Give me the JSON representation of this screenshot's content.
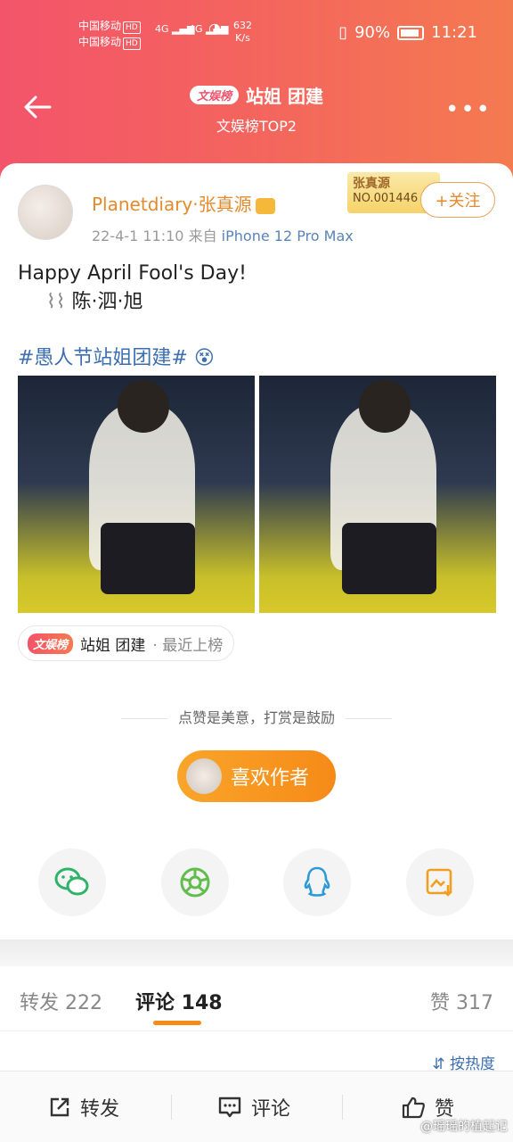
{
  "status_bar": {
    "carrier1": "中国移动",
    "carrier2": "中国移动",
    "hd": "HD",
    "net1": "4G",
    "net2": "4G",
    "speed_value": "632",
    "speed_unit": "K/s",
    "battery": "90%",
    "time": "11:21"
  },
  "header": {
    "badge": "文娱榜",
    "title": "站姐 团建",
    "subtitle": "文娱榜TOP2"
  },
  "post": {
    "username": "Planetdiary·张真源",
    "date": "22-4-1 11:10",
    "from_label": "来自",
    "device": "iPhone 12 Pro Max",
    "fan_badge_name": "张真源",
    "fan_badge_no": "NO.001446",
    "follow_label": "+关注",
    "text_line1": "Happy April Fool's Day!",
    "text_line2": "陈·泗·旭",
    "hashtag": "#愚人节站姐团建#",
    "chip_badge": "文娱榜",
    "chip_title": "站姐 团建",
    "chip_status": "· 最近上榜"
  },
  "reward": {
    "encourage_text": "点赞是美意，打赏是鼓励",
    "like_author_label": "喜欢作者"
  },
  "share": {
    "icons": [
      "wechat-icon",
      "moments-icon",
      "qq-icon",
      "save-image-icon"
    ]
  },
  "tabs": {
    "repost": "转发 222",
    "comment": "评论 148",
    "like": "赞 317",
    "sort": "按热度"
  },
  "bottom_bar": {
    "repost": "转发",
    "comment": "评论",
    "like": "赞"
  },
  "watermark": "@瑶瑶的植起记",
  "colors": {
    "header_start": "#f3546a",
    "header_end": "#f47a50",
    "accent_orange": "#f68a18",
    "link_blue": "#3d6fb0"
  }
}
